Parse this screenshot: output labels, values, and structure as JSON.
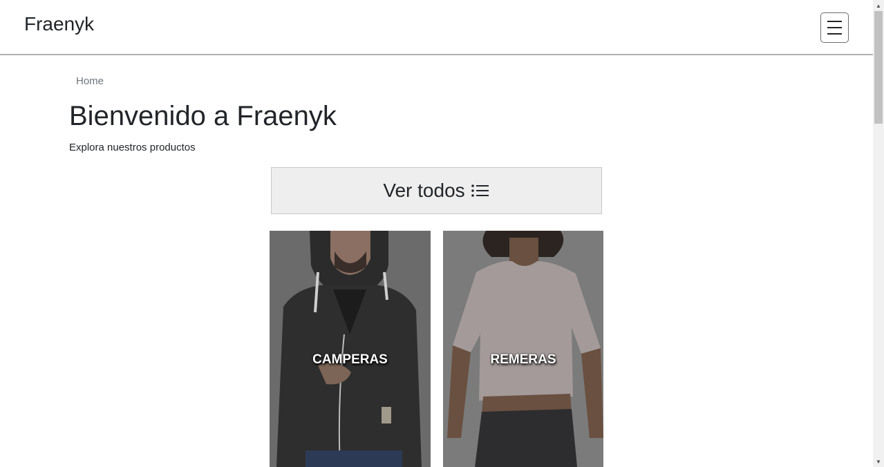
{
  "navbar": {
    "brand": "Fraenyk",
    "menu_icon": "hamburger-icon"
  },
  "breadcrumb": {
    "home": "Home"
  },
  "hero": {
    "title": "Bienvenido a Fraenyk",
    "subtitle": "Explora nuestros productos"
  },
  "view_all": {
    "label": "Ver todos",
    "icon": "list-icon"
  },
  "categories": [
    {
      "label": "CAMPERAS"
    },
    {
      "label": "REMERAS"
    }
  ]
}
